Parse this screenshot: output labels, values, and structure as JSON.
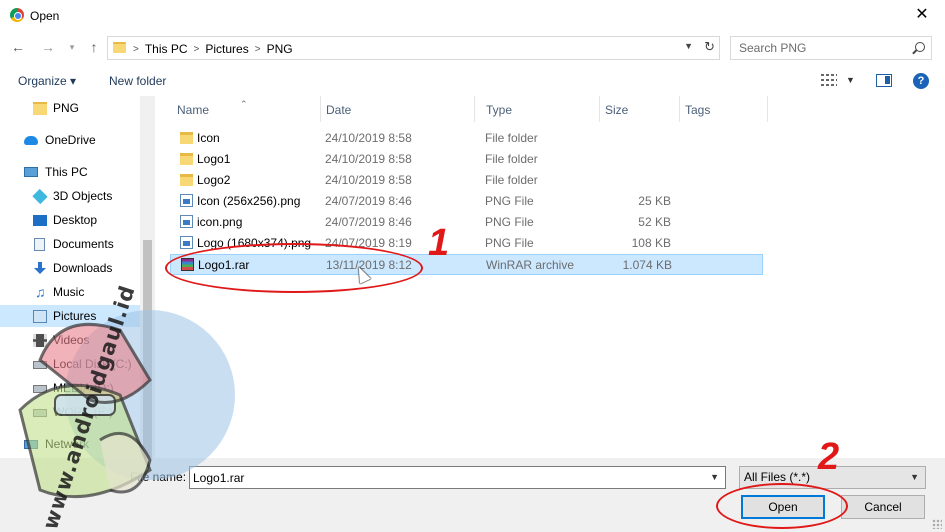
{
  "window": {
    "title": "Open",
    "close_glyph": "✕",
    "icon": "chrome-icon"
  },
  "address_bar": {
    "breadcrumbs": [
      "This PC",
      "Pictures",
      "PNG"
    ],
    "separator": ">"
  },
  "search": {
    "placeholder": "Search PNG"
  },
  "toolbar": {
    "organize_label": "Organize ▾",
    "new_folder_label": "New folder"
  },
  "navigation_pane": {
    "items": [
      {
        "label": "PNG",
        "icon": "folder-icon"
      },
      {
        "label": "OneDrive",
        "icon": "cloud-icon"
      },
      {
        "label": "This PC",
        "icon": "computer-icon"
      },
      {
        "label": "3D Objects",
        "icon": "cube-icon"
      },
      {
        "label": "Desktop",
        "icon": "desktop-icon"
      },
      {
        "label": "Documents",
        "icon": "document-icon"
      },
      {
        "label": "Downloads",
        "icon": "download-icon"
      },
      {
        "label": "Music",
        "icon": "music-icon"
      },
      {
        "label": "Pictures",
        "icon": "pictures-icon",
        "selected": true
      },
      {
        "label": "Videos",
        "icon": "video-icon"
      },
      {
        "label": "Local Disk (C:)",
        "icon": "drive-icon"
      },
      {
        "label": "MEDIA (D:)",
        "icon": "drive-icon"
      },
      {
        "label": "WORK (E:)",
        "icon": "drive-icon"
      },
      {
        "label": "Network",
        "icon": "network-icon"
      }
    ]
  },
  "file_list": {
    "columns": [
      "Name",
      "Date",
      "Type",
      "Size",
      "Tags"
    ],
    "rows": [
      {
        "name": "Icon",
        "date": "24/10/2019 8:58",
        "type": "File folder",
        "size": "",
        "icon": "folder-icon"
      },
      {
        "name": "Logo1",
        "date": "24/10/2019 8:58",
        "type": "File folder",
        "size": "",
        "icon": "folder-icon"
      },
      {
        "name": "Logo2",
        "date": "24/10/2019 8:58",
        "type": "File folder",
        "size": "",
        "icon": "folder-icon"
      },
      {
        "name": "Icon (256x256).png",
        "date": "24/07/2019 8:46",
        "type": "PNG File",
        "size": "25 KB",
        "icon": "image-file-icon"
      },
      {
        "name": "icon.png",
        "date": "24/07/2019 8:46",
        "type": "PNG File",
        "size": "52 KB",
        "icon": "image-file-icon"
      },
      {
        "name": "Logo (1680x374).png",
        "date": "24/07/2019 8:19",
        "type": "PNG File",
        "size": "108 KB",
        "icon": "image-file-icon"
      },
      {
        "name": "Logo1.rar",
        "date": "13/11/2019 8:12",
        "type": "WinRAR archive",
        "size": "1.074 KB",
        "icon": "rar-archive-icon",
        "selected": true
      }
    ]
  },
  "bottom_bar": {
    "file_name_label": "File name:",
    "file_name_value": "Logo1.rar",
    "file_type_value": "All Files (*.*)",
    "open_label": "Open",
    "cancel_label": "Cancel"
  },
  "annotations": {
    "step_1": "1",
    "step_2": "2",
    "color": "#e01818"
  },
  "watermark": {
    "text": "www.androidgaul.id"
  },
  "colors": {
    "selection": "#cce8ff",
    "accent": "#0078d7"
  }
}
